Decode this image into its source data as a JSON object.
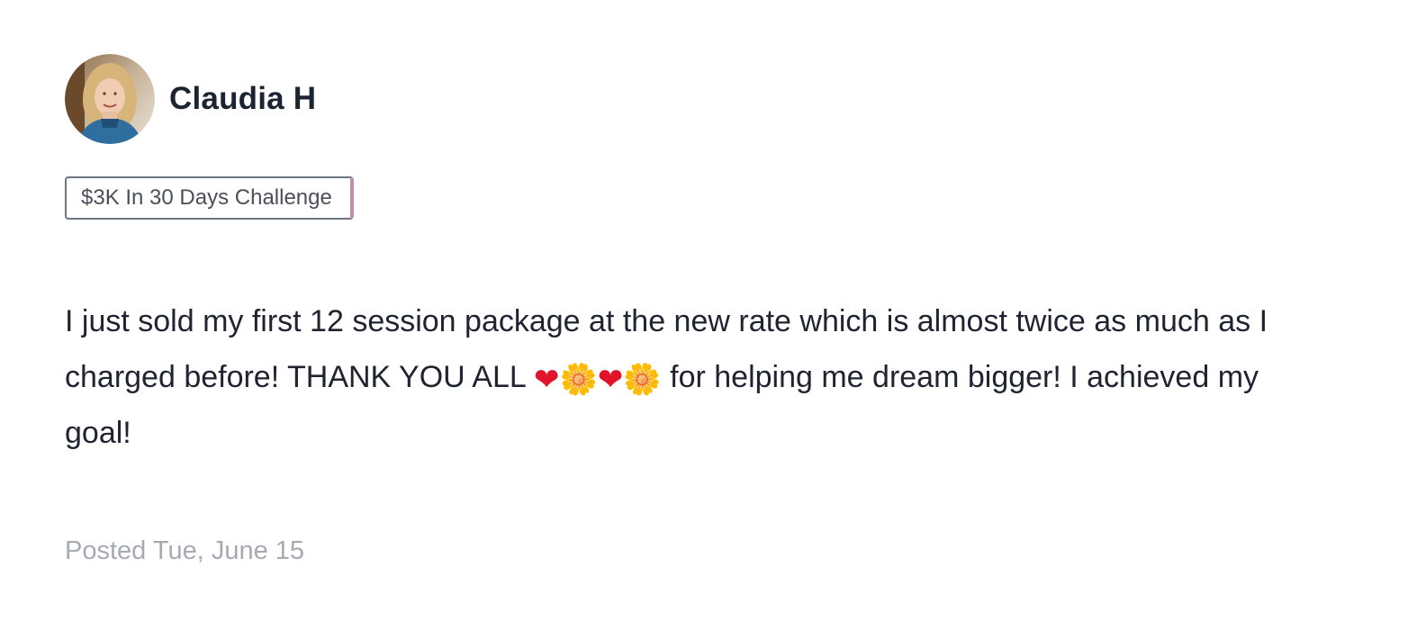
{
  "post": {
    "author": {
      "name": "Claudia H",
      "avatar_icon": "person-photo-avatar"
    },
    "tag": {
      "label": "$3K In 30 Days Challenge",
      "border_color": "#6f7682",
      "accent_color": "#c58ab2"
    },
    "body": {
      "text_part1": "I just sold my first 12 session package at the new rate which is almost twice as much as I charged before! THANK YOU ALL ",
      "emoji": [
        "❤",
        "🌼",
        "❤",
        "🌼"
      ],
      "text_part2": "  for helping me dream bigger! I achieved my goal!"
    },
    "posted": "Posted Tue, June 15"
  },
  "colors": {
    "text_primary": "#1f2430",
    "text_muted": "#a6aab2",
    "background": "#ffffff"
  }
}
